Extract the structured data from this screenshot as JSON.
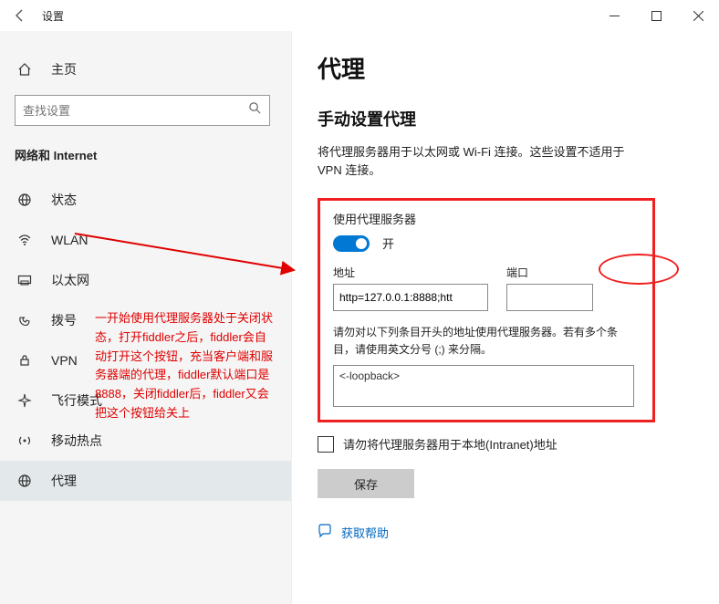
{
  "titlebar": {
    "title": "设置"
  },
  "sidebar": {
    "home": "主页",
    "search_placeholder": "查找设置",
    "section": "网络和 Internet",
    "items": [
      {
        "label": "状态"
      },
      {
        "label": "WLAN"
      },
      {
        "label": "以太网"
      },
      {
        "label": "拨号"
      },
      {
        "label": "VPN"
      },
      {
        "label": "飞行模式"
      },
      {
        "label": "移动热点"
      },
      {
        "label": "代理"
      }
    ]
  },
  "main": {
    "h1": "代理",
    "h2": "手动设置代理",
    "description": "将代理服务器用于以太网或 Wi-Fi 连接。这些设置不适用于 VPN 连接。",
    "use_proxy_label": "使用代理服务器",
    "toggle_state_label": "开",
    "address_label": "地址",
    "address_value": "http=127.0.0.1:8888;htt",
    "port_label": "端口",
    "port_value": "",
    "bypass_description": "请勿对以下列条目开头的地址使用代理服务器。若有多个条目，请使用英文分号 (;) 来分隔。",
    "bypass_value": "<-loopback>",
    "intranet_checkbox_label": "请勿将代理服务器用于本地(Intranet)地址",
    "save_button": "保存",
    "help_link": "获取帮助"
  },
  "annotation": "一开始使用代理服务器处于关闭状态，打开fiddler之后，fiddler会自动打开这个按钮，充当客户端和服务器端的代理，fiddler默认端口是8888，关闭fiddler后，fiddler又会把这个按钮给关上"
}
